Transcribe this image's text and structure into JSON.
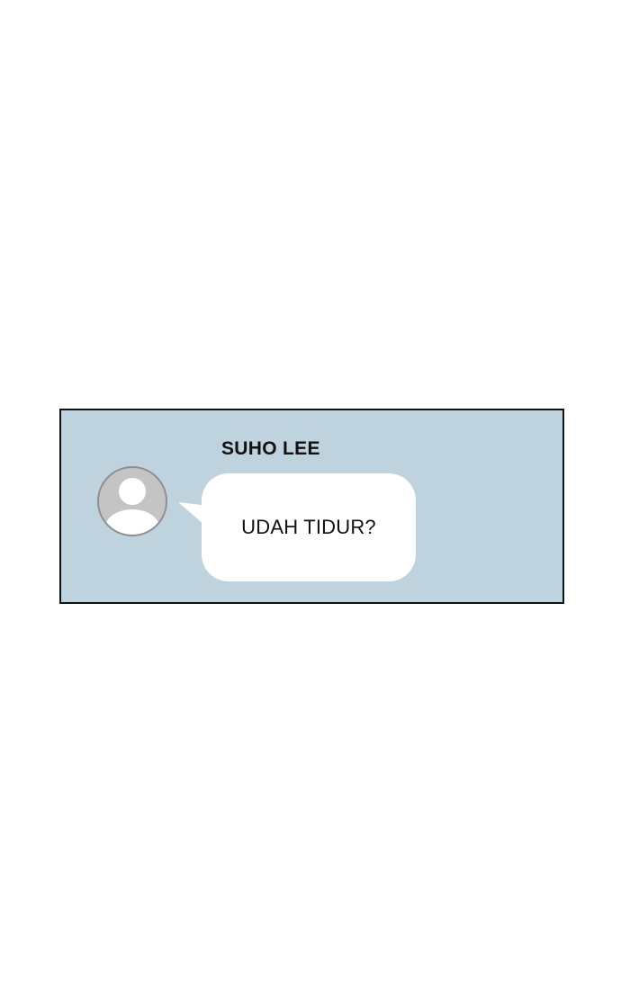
{
  "message": {
    "sender": "SUHO LEE",
    "text": "UDAH TIDUR?",
    "avatar_icon": "default-user-avatar-icon"
  },
  "colors": {
    "page_background": "#ffffff",
    "panel_background": "#bfd3de",
    "panel_border": "#111111",
    "bubble_background": "#ffffff",
    "avatar_fill": "#c4c4c4",
    "avatar_figure": "#ffffff"
  }
}
